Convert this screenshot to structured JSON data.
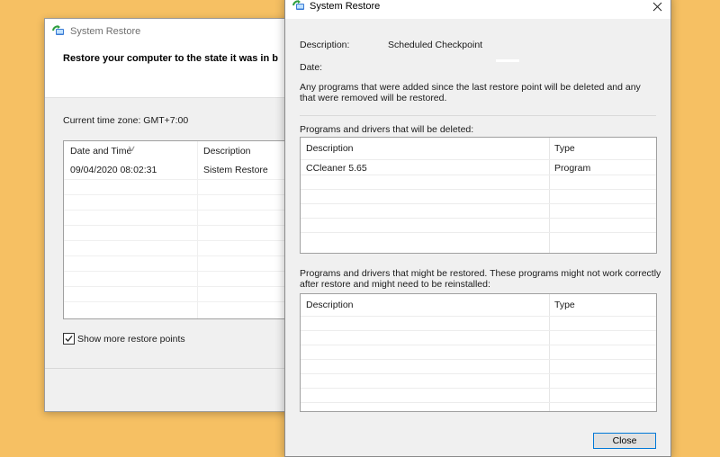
{
  "back_window": {
    "title": "System Restore",
    "heading": "Restore your computer to the state it was in b",
    "timezone": "Current time zone: GMT+7:00",
    "columns": [
      "Date and Time",
      "Description"
    ],
    "rows": [
      {
        "date": "09/04/2020 08:02:31",
        "description": "Sistem Restore"
      }
    ],
    "show_more_label": "Show more restore points",
    "show_more_checked": true
  },
  "front_window": {
    "title": "System Restore",
    "description_label": "Description:",
    "description_value": "Scheduled Checkpoint",
    "date_label": "Date:",
    "warning": "Any programs that were added since the last restore point will be deleted and any that were removed will be restored.",
    "deleted_section": {
      "title": "Programs and drivers that will be deleted:",
      "columns": [
        "Description",
        "Type"
      ],
      "rows": [
        {
          "description": "CCleaner 5.65",
          "type": "Program"
        }
      ]
    },
    "restored_section": {
      "title": "Programs and drivers that might be restored. These programs might not work correctly after restore and might need to be reinstalled:",
      "columns": [
        "Description",
        "Type"
      ],
      "rows": []
    },
    "close_button": "Close"
  },
  "icons": {
    "app": "system-restore-icon",
    "close": "close-icon",
    "check": "checkmark-icon",
    "sort": "sort-arrow-icon"
  },
  "colors": {
    "desktop": "#f6c063",
    "dialog": "#f0f0f0",
    "accent": "#0078d7"
  }
}
